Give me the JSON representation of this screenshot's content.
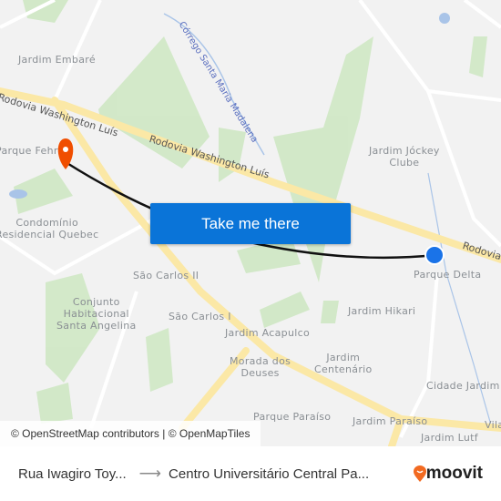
{
  "map": {
    "neighborhoods": [
      "Jardim Embaré",
      "Parque Fehr",
      "Condomínio\nResidencial Quebec",
      "Jardim Jóckey\nClube",
      "Parque Delta",
      "São Carlos II",
      "Conjunto\nHabitacional\nSanta Angelina",
      "São Carlos I",
      "Jardim Hikari",
      "Jardim Acapulco",
      "Morada dos\nDeuses",
      "Jardim\nCentenário",
      "Cidade Jardim",
      "Parque Paraíso",
      "Jardim Paraíso",
      "Jardim Lutf",
      "Vila"
    ],
    "roads": [
      "Rodovia Washington Luís",
      "Rodovia Washington Luís",
      "Rodovia"
    ],
    "waterways": [
      "Córrego Santa Maria Madalena"
    ],
    "origin_marker_color": "#1a73e8",
    "destination_marker_color": "#f04e00",
    "route_color": "#111111"
  },
  "cta": {
    "label": "Take me there"
  },
  "attribution": "© OpenStreetMap contributors | © OpenMapTiles",
  "footer": {
    "origin": "Rua Iwagiro Toy...",
    "destination": "Centro Universitário Central Pa...",
    "brand": "moovit",
    "brand_color": "#f26a21"
  }
}
